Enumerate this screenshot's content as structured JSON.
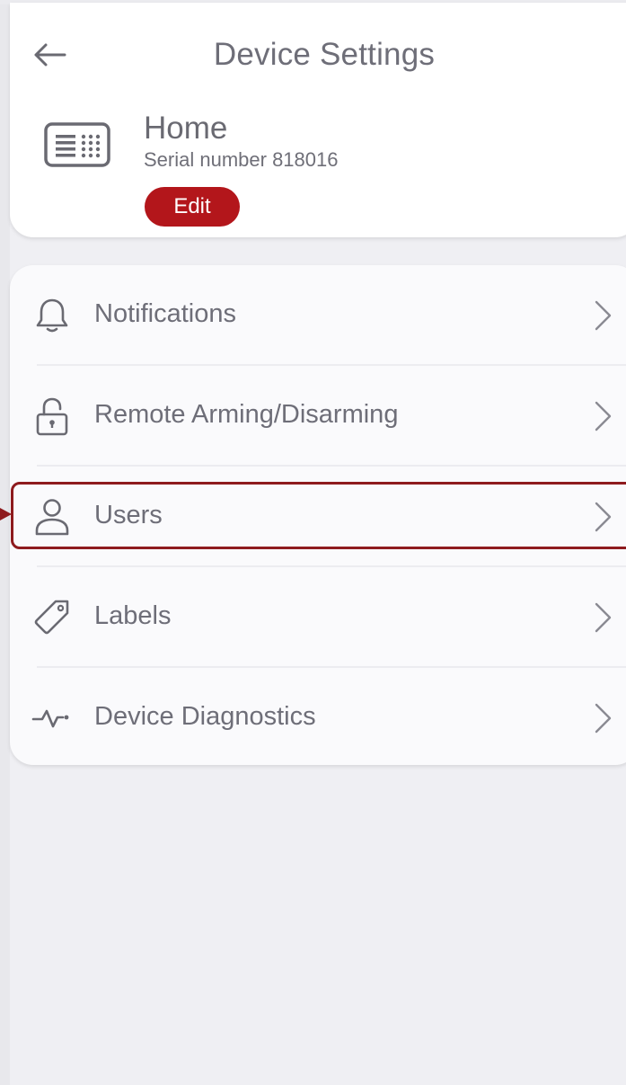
{
  "header": {
    "title": "Device Settings",
    "device_name": "Home",
    "serial": "Serial number 818016",
    "edit_label": "Edit"
  },
  "menu": {
    "items": [
      {
        "label": "Notifications",
        "icon": "bell-icon"
      },
      {
        "label": "Remote Arming/Disarming",
        "icon": "lock-icon"
      },
      {
        "label": "Users",
        "icon": "user-icon"
      },
      {
        "label": "Labels",
        "icon": "tag-icon"
      },
      {
        "label": "Device Diagnostics",
        "icon": "pulse-icon"
      }
    ]
  },
  "colors": {
    "accent": "#b3161b",
    "highlight": "#8e1b1e",
    "text": "#6e6e78",
    "background": "#efeff3"
  }
}
